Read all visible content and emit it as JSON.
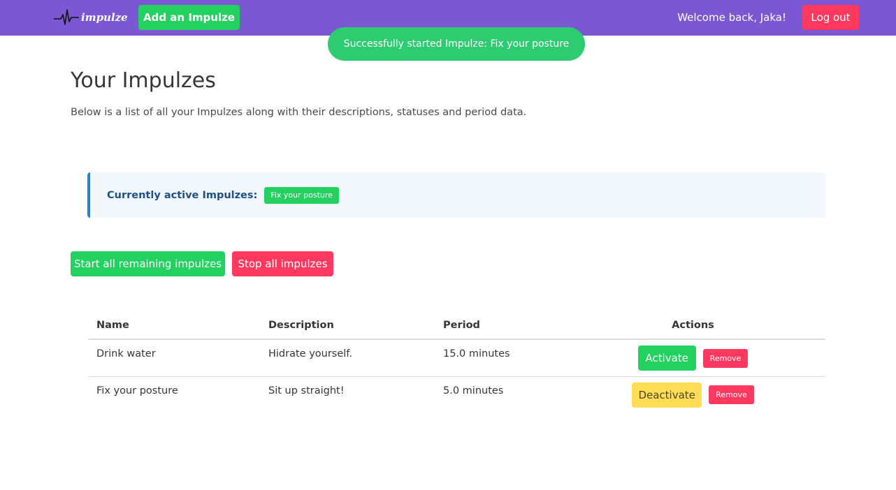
{
  "navbar": {
    "brand_text": "impulze",
    "add_button_label": "Add an Impulze",
    "welcome_text": "Welcome back, Jaka!",
    "logout_label": "Log out",
    "background_color": "#7b57d3"
  },
  "toast": {
    "message": "Successfully started Impulze: Fix your posture"
  },
  "main": {
    "title": "Your Impulzes",
    "subtitle": "Below is a list of all your Impulzes along with their descriptions, statuses and period data."
  },
  "active_box": {
    "label": "Currently active Impulzes:",
    "active_tags": [
      "Fix your posture"
    ]
  },
  "bulk_actions": {
    "start_all_label": "Start all remaining impulzes",
    "stop_all_label": "Stop all impulzes"
  },
  "table": {
    "headers": {
      "name": "Name",
      "description": "Description",
      "period": "Period",
      "actions": "Actions"
    },
    "rows": [
      {
        "name": "Drink water",
        "description": "Hidrate yourself.",
        "period": "15.0 minutes",
        "toggle_label": "Activate",
        "remove_label": "Remove"
      },
      {
        "name": "Fix your posture",
        "description": "Sit up straight!",
        "period": "5.0 minutes",
        "toggle_label": "Deactivate",
        "remove_label": "Remove"
      }
    ]
  },
  "colors": {
    "success": "#23d160",
    "danger": "#ff3860",
    "warning": "#ffdd57",
    "info_border": "#2f7fd1"
  }
}
